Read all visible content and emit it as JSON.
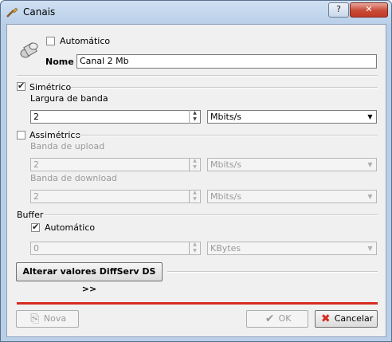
{
  "window": {
    "title": "Canais",
    "help_label": "?",
    "close_label": "✕"
  },
  "header": {
    "automatic_label": "Automático",
    "automatic_checked": false,
    "name_label": "Nome",
    "name_value": "Canal 2 Mb",
    "icon": "cable-icon"
  },
  "symmetric": {
    "label": "Simétrico",
    "checked": true,
    "bandwidth_label": "Largura de banda",
    "bandwidth_value": "2",
    "unit_value": "Mbits/s"
  },
  "asymmetric": {
    "label": "Assimétrico",
    "checked": false,
    "upload_label": "Banda de upload",
    "upload_value": "2",
    "upload_unit": "Mbits/s",
    "download_label": "Banda de download",
    "download_value": "2",
    "download_unit": "Mbits/s"
  },
  "buffer": {
    "label": "Buffer",
    "automatic_label": "Automático",
    "automatic_checked": true,
    "value": "0",
    "unit": "KBytes"
  },
  "diffserv_button_label": "Alterar valores DiffServ DS >>",
  "footer": {
    "new_label": "Nova",
    "ok_label": "OK",
    "cancel_label": "Cancelar"
  },
  "colors": {
    "accent_line": "#d62b1f",
    "close_button": "#c74a36"
  }
}
